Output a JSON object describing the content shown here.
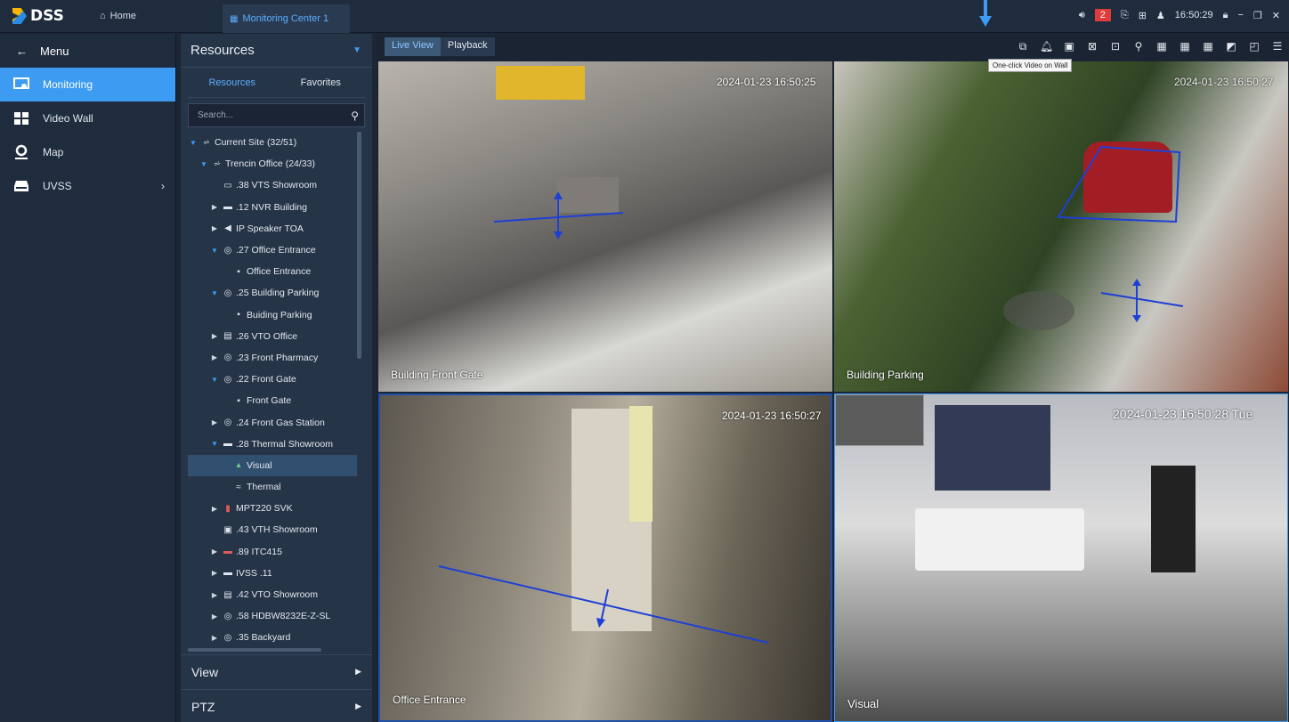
{
  "app": {
    "logo": "DSS",
    "home_tab": "Home",
    "active_tab": "Monitoring Center 1"
  },
  "topbar": {
    "alarm_count": "2",
    "time": "16:50:29"
  },
  "nav": {
    "menu_label": "Menu",
    "items": [
      {
        "label": "Monitoring",
        "icon": "monitoring-icon"
      },
      {
        "label": "Video Wall",
        "icon": "video-wall-icon"
      },
      {
        "label": "Map",
        "icon": "map-icon"
      },
      {
        "label": "UVSS",
        "icon": "uvss-icon"
      }
    ]
  },
  "resources": {
    "title": "Resources",
    "tabs": [
      "Resources",
      "Favorites"
    ],
    "search_placeholder": "Search...",
    "tree": [
      {
        "label": "Current Site (32/51)"
      },
      {
        "label": "Trencin Office (24/33)"
      },
      {
        "label": ".38 VTS Showroom"
      },
      {
        "label": ".12 NVR Building"
      },
      {
        "label": "IP Speaker TOA"
      },
      {
        "label": ".27 Office Entrance"
      },
      {
        "label": "Office Entrance"
      },
      {
        "label": ".25 Building Parking"
      },
      {
        "label": "Buiding Parking"
      },
      {
        "label": ".26 VTO Office"
      },
      {
        "label": ".23 Front Pharmacy"
      },
      {
        "label": ".22 Front Gate"
      },
      {
        "label": "Front Gate"
      },
      {
        "label": ".24 Front Gas Station"
      },
      {
        "label": ".28 Thermal Showroom"
      },
      {
        "label": "Visual"
      },
      {
        "label": "Thermal"
      },
      {
        "label": "MPT220 SVK"
      },
      {
        "label": ".43 VTH Showroom"
      },
      {
        "label": ".89 ITC415"
      },
      {
        "label": "IVSS .11"
      },
      {
        "label": ".42 VTO Showroom"
      },
      {
        "label": ".58 HDBW8232E-Z-SL"
      },
      {
        "label": ".35 Backyard"
      }
    ],
    "sections": [
      "View",
      "PTZ"
    ]
  },
  "main": {
    "tabs": [
      "Live View",
      "Playback"
    ],
    "tooltip": "One-click Video on Wall"
  },
  "videos": [
    {
      "camera": "Building Front Gate",
      "timestamp": "2024-01-23 16:50:25"
    },
    {
      "camera": "Building Parking",
      "timestamp": "2024-01-23 16:50:27"
    },
    {
      "camera": "Office Entrance",
      "timestamp": "2024-01-23 16:50:27"
    },
    {
      "camera": "Visual",
      "timestamp": "2024-01-23 16:50:28 Tue"
    }
  ],
  "colors": {
    "accent": "#3d9cf2",
    "badge": "#e03b3b",
    "rule_line": "#1e3fd6"
  }
}
